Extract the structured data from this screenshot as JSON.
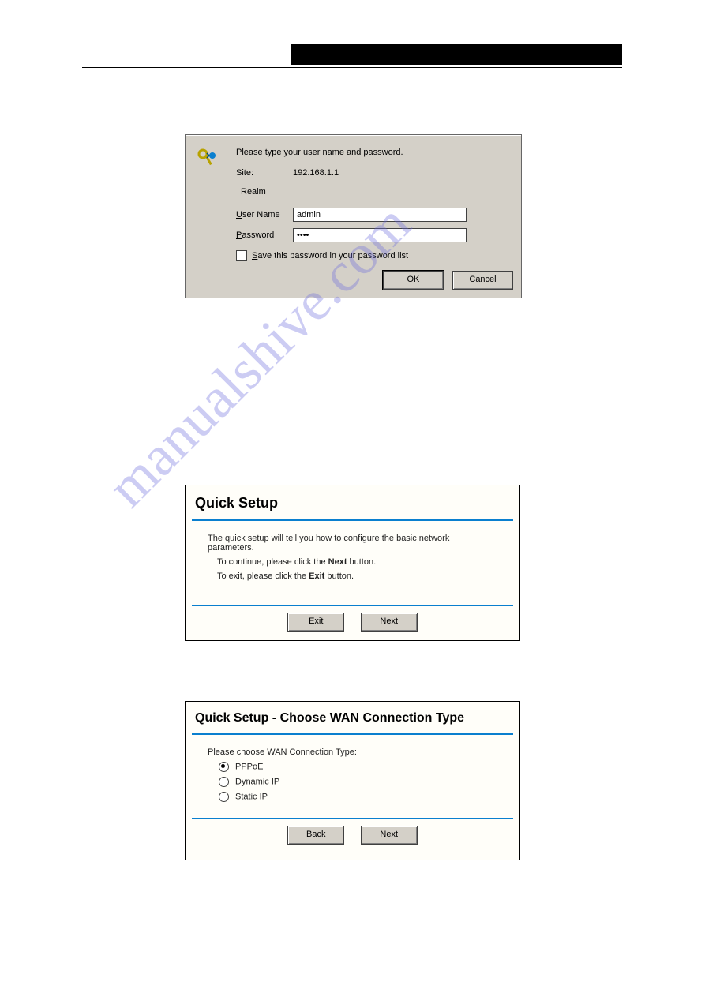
{
  "watermark": "manualshive.com",
  "auth_dialog": {
    "prompt": "Please type your user name and password.",
    "site_label": "Site:",
    "site_value": "192.168.1.1",
    "realm_label": "Realm",
    "username_label_pre": "U",
    "username_label_post": "ser Name",
    "username_value": "admin",
    "password_label_pre": "P",
    "password_label_post": "assword",
    "password_value": "••••",
    "save_pre": "S",
    "save_post": "ave this password in your password list",
    "ok": "OK",
    "cancel": "Cancel"
  },
  "quick_setup": {
    "title": "Quick Setup",
    "intro": "The quick setup will tell you how to configure the basic network parameters.",
    "continue_pre": "To continue, please click the ",
    "continue_bold": "Next",
    "continue_post": " button.",
    "exit_pre": "To exit, please click the ",
    "exit_bold": "Exit",
    "exit_post": " button.",
    "btn_exit": "Exit",
    "btn_next": "Next"
  },
  "wan_setup": {
    "title": "Quick Setup - Choose WAN Connection Type",
    "prompt": "Please choose WAN Connection Type:",
    "options": {
      "pppoe": "PPPoE",
      "dynamic": "Dynamic IP",
      "static": "Static IP"
    },
    "btn_back": "Back",
    "btn_next": "Next"
  }
}
